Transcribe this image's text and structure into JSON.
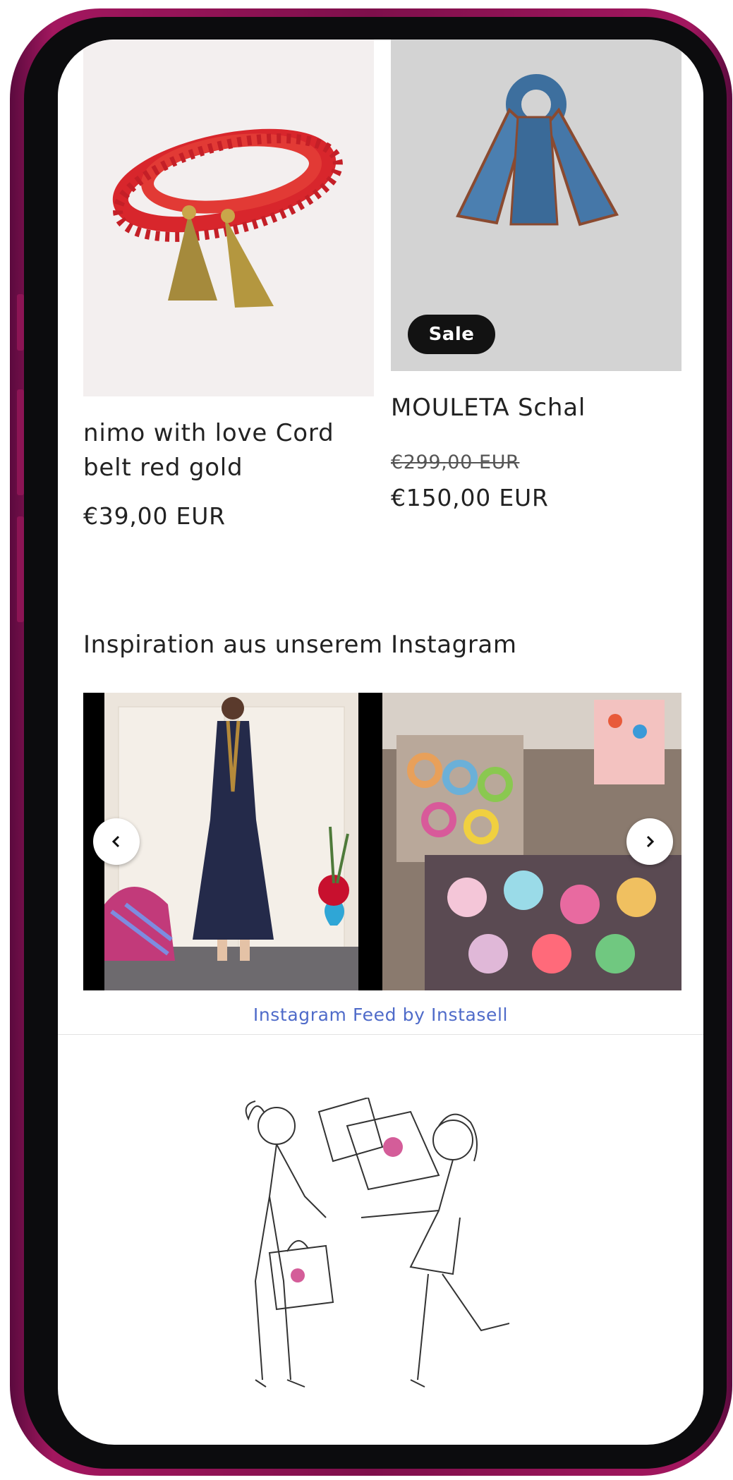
{
  "products": [
    {
      "title_line1": "nimo with love Cord",
      "title_line2": "belt red gold",
      "price": "€39,00 EUR"
    },
    {
      "title": "MOULETA Schal",
      "badge": "Sale",
      "old_price": "€299,00 EUR",
      "price": "€150,00 EUR"
    }
  ],
  "instagram": {
    "heading": "Inspiration aus unserem Instagram",
    "credit": "Instagram Feed by Instasell",
    "prev_icon": "chevron-left-icon",
    "next_icon": "chevron-right-icon"
  },
  "colors": {
    "phone_frame": "#8c1454",
    "link": "#4f6bc9",
    "badge_bg": "#121212"
  }
}
